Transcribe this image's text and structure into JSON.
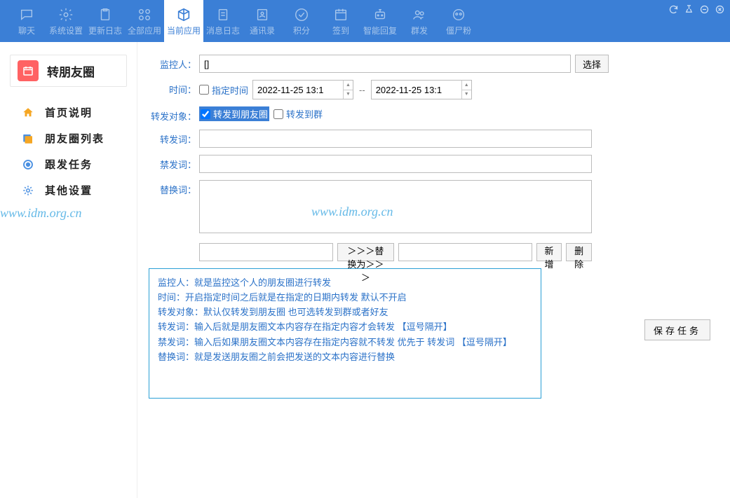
{
  "toolbar": {
    "items": [
      {
        "label": "聊天",
        "icon": "chat-icon"
      },
      {
        "label": "系统设置",
        "icon": "gear-icon"
      },
      {
        "label": "更新日志",
        "icon": "clipboard-icon"
      },
      {
        "label": "全部应用",
        "icon": "grid-icon"
      },
      {
        "label": "当前应用",
        "icon": "cube-icon",
        "active": true
      },
      {
        "label": "消息日志",
        "icon": "clipboard-icon"
      },
      {
        "label": "通讯录",
        "icon": "contacts-icon"
      },
      {
        "label": "积分",
        "icon": "check-icon"
      },
      {
        "label": "签到",
        "icon": "calendar-icon"
      },
      {
        "label": "智能回复",
        "icon": "robot-icon"
      },
      {
        "label": "群发",
        "icon": "group-icon"
      },
      {
        "label": "僵尸粉",
        "icon": "zombie-icon"
      }
    ],
    "window_buttons": [
      "refresh",
      "pin",
      "minimize",
      "close"
    ]
  },
  "sidebar": {
    "title": "转朋友圈",
    "items": [
      {
        "label": "首页说明",
        "icon": "home-icon",
        "color": "#f5a623"
      },
      {
        "label": "朋友圈列表",
        "icon": "list-icon",
        "color": "#4a90e2"
      },
      {
        "label": "跟发任务",
        "icon": "task-icon",
        "color": "#4a90e2"
      },
      {
        "label": "其他设置",
        "icon": "gear-icon",
        "color": "#4a90e2"
      }
    ]
  },
  "form": {
    "monitor_label": "监控人：",
    "monitor_value": "[]",
    "select_button": "选择",
    "time_label": "时间：",
    "time_checkbox": "指定时间",
    "time_from": "2022-11-25 13:1",
    "time_sep": "--",
    "time_to": "2022-11-25 13:1",
    "target_label": "转发对象：",
    "target_friends": "转发到朋友圈",
    "target_friends_checked": true,
    "target_group": "转发到群",
    "target_group_checked": false,
    "forward_word_label": "转发词：",
    "forward_word_value": "",
    "forbid_word_label": "禁发词：",
    "forbid_word_value": "",
    "replace_word_label": "替换词：",
    "replace_word_value": "",
    "replace_from": "",
    "replace_button": "＞＞＞替换为＞＞＞",
    "replace_to": "",
    "add_button": "新增",
    "delete_button": "删除",
    "save_button": "保存任务"
  },
  "help": {
    "line1": "监控人：就是监控这个人的朋友圈进行转发",
    "line2": "时间：开启指定时间之后就是在指定的日期内转发 默认不开启",
    "line3": "转发对象：默认仅转发到朋友圈 也可选转发到群或者好友",
    "line4": "转发词：输入后就是朋友圈文本内容存在指定内容才会转发 【逗号隔开】",
    "line5": "禁发词：输入后如果朋友圈文本内容存在指定内容就不转发 优先于 转发词 【逗号隔开】",
    "line6": "替换词：就是发送朋友圈之前会把发送的文本内容进行替换"
  },
  "watermark": "www.idm.org.cn"
}
